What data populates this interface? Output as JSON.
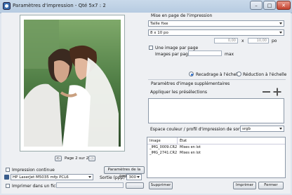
{
  "window": {
    "title": "Paramètres d'impression - Qté 5x7 : 2"
  },
  "preview": {
    "page_indicator": "Page 2 sur 2",
    "prev_label": "<-",
    "next_label": "->"
  },
  "left": {
    "continuous_label": "Impression continue",
    "page_settings_button": "Paramètres de la page",
    "printer": "HP LaserJet M5035 mfp PCL6",
    "output_label": "Sortie (ppp)",
    "output_value": "300",
    "print_to_file_label": "Imprimer dans un fichier"
  },
  "layout": {
    "section_title": "Mise en page de l'impression",
    "size_mode": "Taille fixe",
    "size_value": "8 x 10 po",
    "width_value": "0,00",
    "height_value": "10,00",
    "x_label": "x",
    "po_label": "po",
    "one_per_page_label": "Une image par page",
    "images_per_page_label": "Images par page",
    "max_label": "max",
    "crop_label": "Recadrage à l'échelle",
    "reduce_label": "Réduction à l'échelle"
  },
  "extra": {
    "section_title": "Paramètres d'image supplémentaires",
    "presets_label": "Appliquer les présélections",
    "colorspace_label": "Espace couleur / profil d'impression de sortie",
    "colorspace_value": "srgb"
  },
  "queue": {
    "columns": [
      "Image",
      "État"
    ],
    "rows": [
      {
        "image": "_IMG_0009.CR2",
        "state": "Mises en lot"
      },
      {
        "image": "_IMG_2741.CR2",
        "state": "Mises en lot"
      }
    ]
  },
  "footer": {
    "delete": "Supprimer",
    "print": "Imprimer",
    "close": "Fermer"
  },
  "colors": {
    "accent": "#2b6fd0",
    "window_bg": "#eef0f3"
  }
}
